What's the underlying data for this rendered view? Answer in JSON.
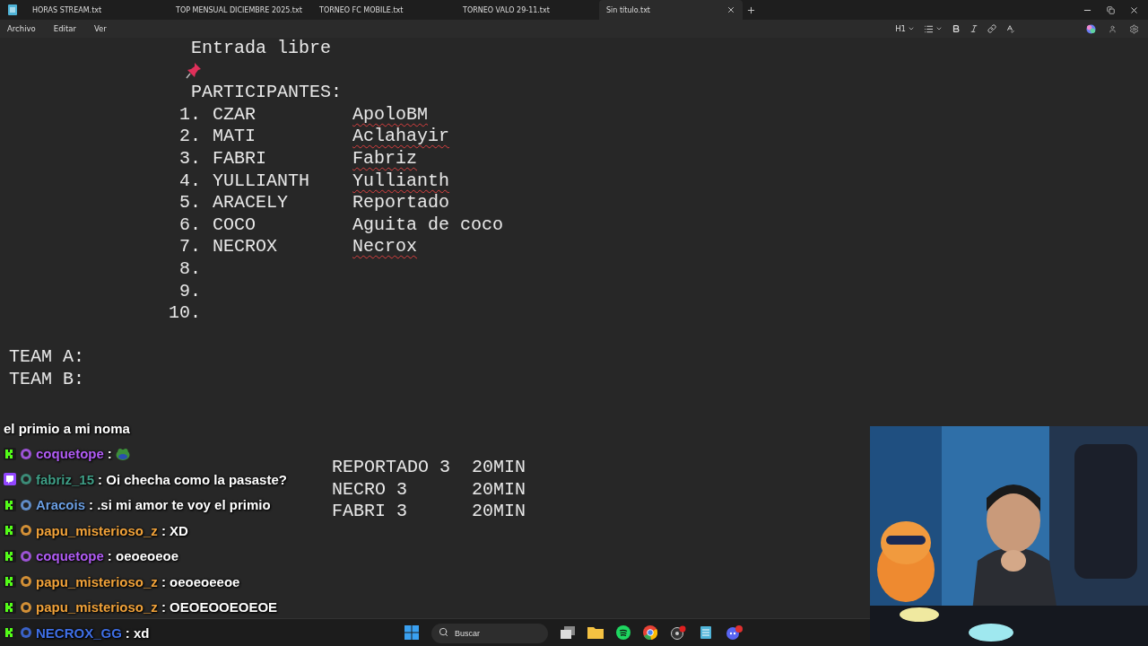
{
  "tabs": [
    {
      "label": "HORAS STREAM.txt",
      "selected": false
    },
    {
      "label": "TOP MENSUAL DICIEMBRE 2025.txt",
      "selected": false
    },
    {
      "label": "TORNEO FC MOBILE.txt",
      "selected": false
    },
    {
      "label": "TORNEO VALO 29-11.txt",
      "selected": false
    },
    {
      "label": "Sin título.txt",
      "selected": true
    }
  ],
  "menu": [
    "Archivo",
    "Editar",
    "Ver"
  ],
  "toolbar": {
    "heading": "H1"
  },
  "document": {
    "header": "Entrada libre",
    "participants_title": "PARTICIPANTES:",
    "participants": [
      {
        "number": "1.",
        "name": "CZAR",
        "alias": "ApoloBM",
        "misspelled": true
      },
      {
        "number": "2.",
        "name": "MATI",
        "alias": "Aclahayir",
        "misspelled": true
      },
      {
        "number": "3.",
        "name": "FABRI",
        "alias": "Fabriz",
        "misspelled": true
      },
      {
        "number": "4.",
        "name": "YULLIANTH",
        "alias": "Yullianth",
        "misspelled": true
      },
      {
        "number": "5.",
        "name": "ARACELY",
        "alias": "Reportado",
        "misspelled": false
      },
      {
        "number": "6.",
        "name": "COCO",
        "alias": "Aguita de coco",
        "misspelled": false
      },
      {
        "number": "7.",
        "name": "NECROX",
        "alias": "Necrox",
        "misspelled": true
      },
      {
        "number": "8."
      },
      {
        "number": "9."
      },
      {
        "number": "10."
      }
    ],
    "teams": [
      "TEAM A:",
      "TEAM B:"
    ],
    "winners": [
      {
        "name": "REPORTADO 3",
        "time": "20MIN"
      },
      {
        "name": "NECRO 3",
        "time": "20MIN"
      },
      {
        "name": "FABRI 3",
        "time": "20MIN"
      }
    ]
  },
  "chat": [
    {
      "kind": "continuation",
      "text": "el primio a mi noma"
    },
    {
      "kind": "message",
      "platform": {
        "kind": "kick"
      },
      "user": "coquetope",
      "color": "#b15cf5",
      "emote": true,
      "text": ":"
    },
    {
      "kind": "message",
      "platform": {
        "kind": "twitch"
      },
      "user": "fabriz_15",
      "color": "#3f9e86",
      "text": ": Oi checha como la pasaste?"
    },
    {
      "kind": "message",
      "platform": {
        "kind": "kick"
      },
      "user": "Aracois",
      "color": "#6b9fe3",
      "text": ": .si mi amor te voy el primio"
    },
    {
      "kind": "message",
      "platform": {
        "kind": "kick"
      },
      "user": "papu_misterioso_z",
      "color": "#f2a33a",
      "text": ": XD"
    },
    {
      "kind": "message",
      "platform": {
        "kind": "kick"
      },
      "user": "coquetope",
      "color": "#b15cf5",
      "text": ": oeoeoeoe"
    },
    {
      "kind": "message",
      "platform": {
        "kind": "kick"
      },
      "user": "papu_misterioso_z",
      "color": "#f2a33a",
      "text": ": oeoeoeeoe"
    },
    {
      "kind": "message",
      "platform": {
        "kind": "kick"
      },
      "user": "papu_misterioso_z",
      "color": "#f2a33a",
      "text": ": OEOEOOEOEOE"
    },
    {
      "kind": "message",
      "platform": {
        "kind": "kick"
      },
      "user": "NECROX_GG",
      "color": "#3f6fe6",
      "text": ": xd"
    }
  ],
  "taskbar": {
    "search": {
      "placeholder": "Buscar"
    }
  }
}
